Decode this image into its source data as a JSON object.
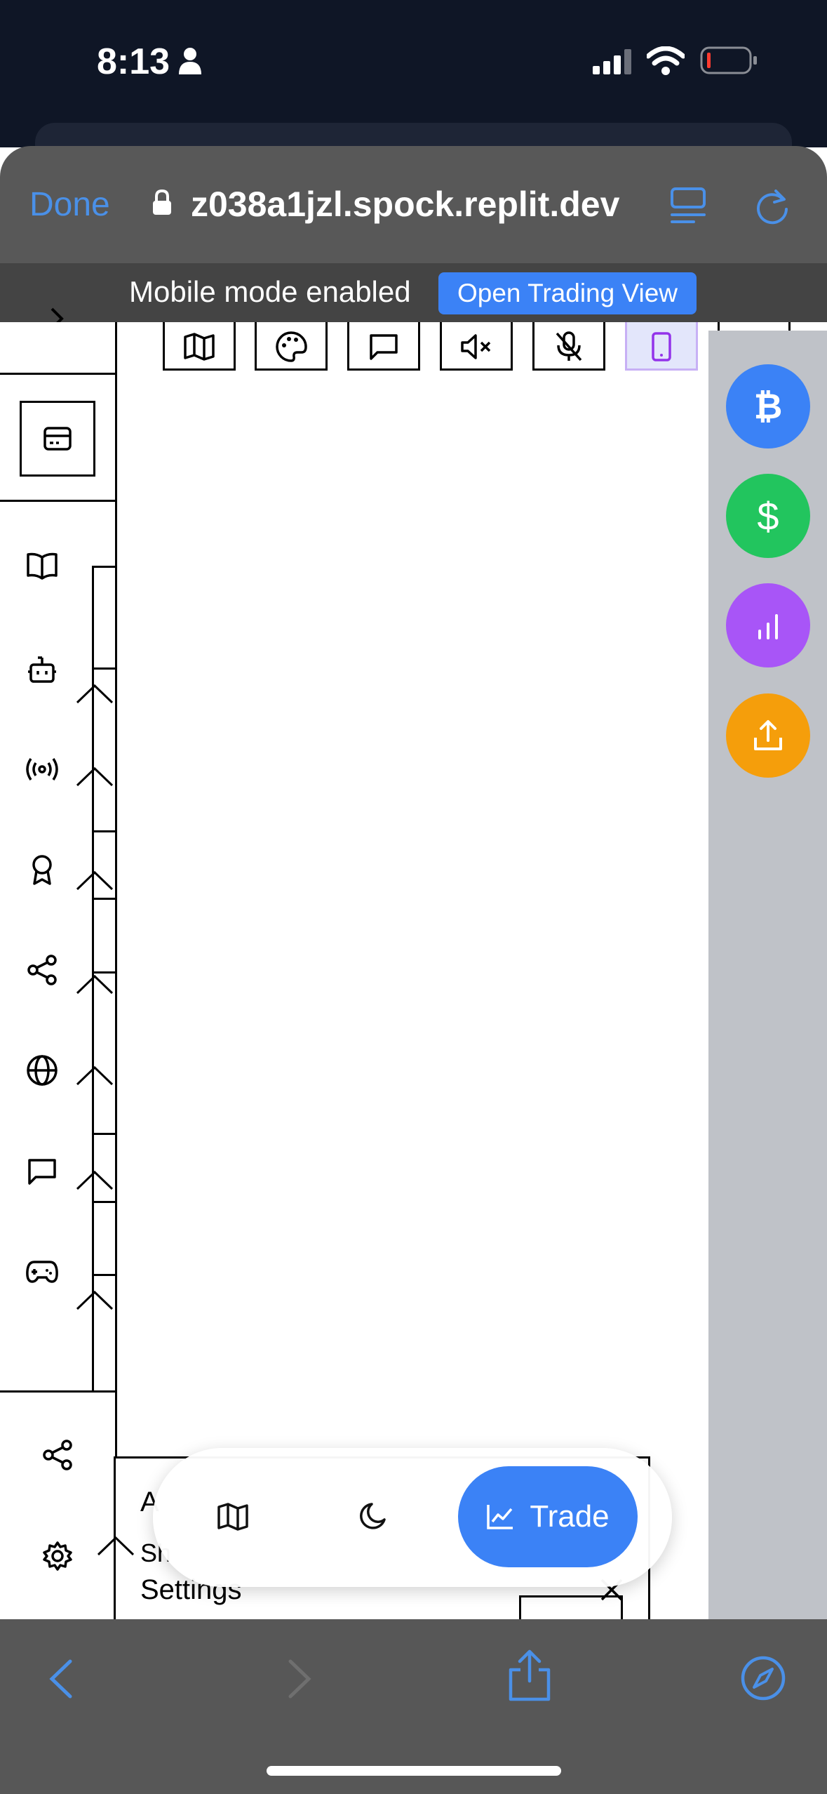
{
  "status_bar": {
    "time": "8:13"
  },
  "safari": {
    "done_label": "Done",
    "url": "z038a1jzl.spock.replit.dev",
    "notice_text": "Mobile mode enabled",
    "open_trading_view_label": "Open Trading View"
  },
  "fab": {
    "bitcoin_symbol": "₿",
    "dollar_symbol": "$"
  },
  "settings_panel": {
    "title_fragment": "A",
    "subtitle_fragment": "Sh",
    "settings_label": "Settings"
  },
  "bottom_bar": {
    "trade_label": "Trade"
  },
  "colors": {
    "blue": "#3b82f6",
    "green": "#22c55e",
    "purple": "#a855f7",
    "orange": "#f59e0b",
    "safari_accent": "#4a90e8"
  }
}
